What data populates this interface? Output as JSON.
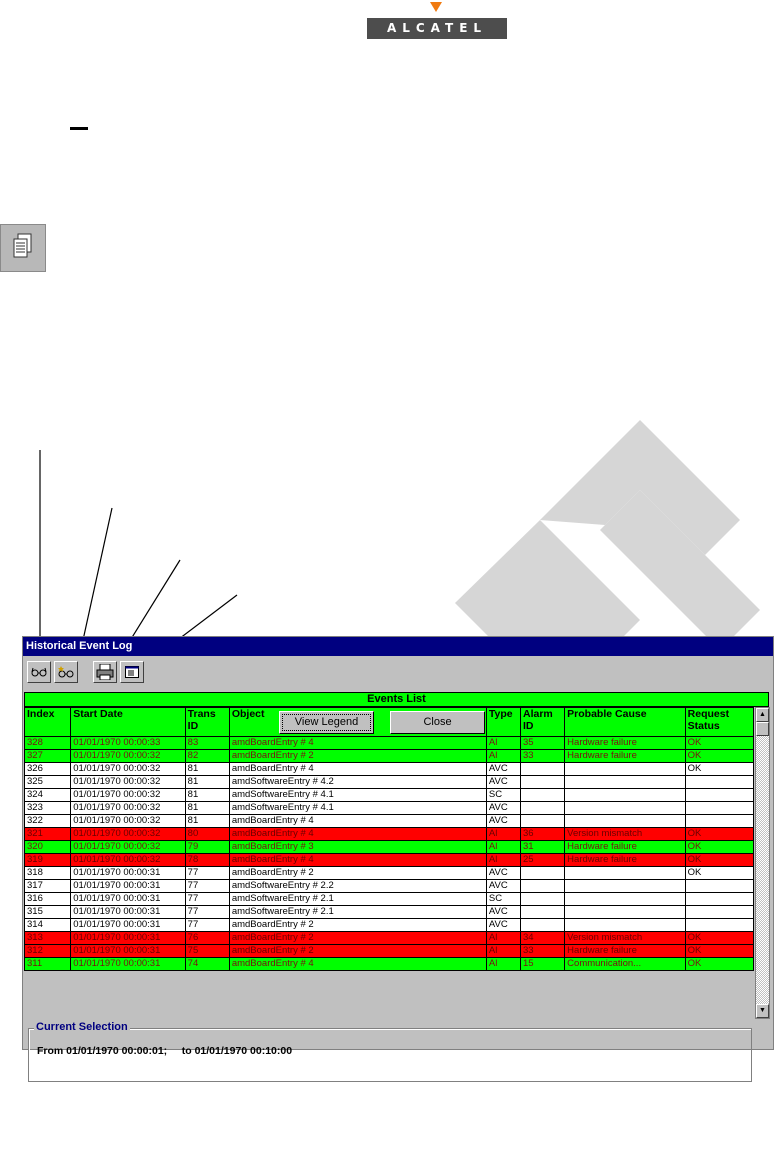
{
  "logo": {
    "text": "ALCATEL"
  },
  "window": {
    "title": "Historical Event Log"
  },
  "toolbar": [
    {
      "name": "view-events-icon",
      "glyph": "○○"
    },
    {
      "name": "view-new-events-icon",
      "glyph": "○○"
    },
    {
      "name": "print-icon",
      "glyph": "🖶"
    },
    {
      "name": "details-icon",
      "glyph": "▤"
    }
  ],
  "events": {
    "title": "Events List",
    "columns": [
      "Index",
      "Start Date",
      "Trans ID",
      "Object",
      "Type",
      "Alarm ID",
      "Probable Cause",
      "Request Status"
    ],
    "rows": [
      {
        "color": "green",
        "cells": [
          "328",
          "01/01/1970 00:00:33",
          "83",
          "amdBoardEntry # 4",
          "Al",
          "35",
          "Hardware failure",
          "OK"
        ]
      },
      {
        "color": "green",
        "cells": [
          "327",
          "01/01/1970 00:00:32",
          "82",
          "amdBoardEntry # 2",
          "Al",
          "33",
          "Hardware failure",
          "OK"
        ]
      },
      {
        "color": "white",
        "cells": [
          "326",
          "01/01/1970 00:00:32",
          "81",
          "amdBoardEntry # 4",
          "AVC",
          "",
          "",
          "OK"
        ]
      },
      {
        "color": "white",
        "cells": [
          "325",
          "01/01/1970 00:00:32",
          "81",
          "amdSoftwareEntry # 4.2",
          "AVC",
          "",
          "",
          ""
        ]
      },
      {
        "color": "white",
        "cells": [
          "324",
          "01/01/1970 00:00:32",
          "81",
          "amdSoftwareEntry # 4.1",
          "SC",
          "",
          "",
          ""
        ]
      },
      {
        "color": "white",
        "cells": [
          "323",
          "01/01/1970 00:00:32",
          "81",
          "amdSoftwareEntry # 4.1",
          "AVC",
          "",
          "",
          ""
        ]
      },
      {
        "color": "white",
        "cells": [
          "322",
          "01/01/1970 00:00:32",
          "81",
          "amdBoardEntry # 4",
          "AVC",
          "",
          "",
          ""
        ]
      },
      {
        "color": "red",
        "cells": [
          "321",
          "01/01/1970 00:00:32",
          "80",
          "amdBoardEntry # 4",
          "Al",
          "36",
          "Version mismatch",
          "OK"
        ]
      },
      {
        "color": "green",
        "cells": [
          "320",
          "01/01/1970 00:00:32",
          "79",
          "amdBoardEntry # 3",
          "Al",
          "31",
          "Hardware failure",
          "OK"
        ]
      },
      {
        "color": "red",
        "cells": [
          "319",
          "01/01/1970 00:00:32",
          "78",
          "amdBoardEntry # 4",
          "Al",
          "25",
          "Hardware failure",
          "OK"
        ]
      },
      {
        "color": "white",
        "cells": [
          "318",
          "01/01/1970 00:00:31",
          "77",
          "amdBoardEntry # 2",
          "AVC",
          "",
          "",
          "OK"
        ]
      },
      {
        "color": "white",
        "cells": [
          "317",
          "01/01/1970 00:00:31",
          "77",
          "amdSoftwareEntry # 2.2",
          "AVC",
          "",
          "",
          ""
        ]
      },
      {
        "color": "white",
        "cells": [
          "316",
          "01/01/1970 00:00:31",
          "77",
          "amdSoftwareEntry # 2.1",
          "SC",
          "",
          "",
          ""
        ]
      },
      {
        "color": "white",
        "cells": [
          "315",
          "01/01/1970 00:00:31",
          "77",
          "amdSoftwareEntry # 2.1",
          "AVC",
          "",
          "",
          ""
        ]
      },
      {
        "color": "white",
        "cells": [
          "314",
          "01/01/1970 00:00:31",
          "77",
          "amdBoardEntry # 2",
          "AVC",
          "",
          "",
          ""
        ]
      },
      {
        "color": "red",
        "cells": [
          "313",
          "01/01/1970 00:00:31",
          "76",
          "amdBoardEntry # 2",
          "Al",
          "34",
          "Version mismatch",
          "OK"
        ]
      },
      {
        "color": "red",
        "cells": [
          "312",
          "01/01/1970 00:00:31",
          "75",
          "amdBoardEntry # 2",
          "Al",
          "33",
          "Hardware failure",
          "OK"
        ]
      },
      {
        "color": "green",
        "cells": [
          "311",
          "01/01/1970 00:00:31",
          "74",
          "amdBoardEntry # 4",
          "Al",
          "15",
          "Communication...",
          "OK"
        ]
      }
    ]
  },
  "selection": {
    "label": "Current Selection",
    "text": "From 01/01/1970 00:00:01;     to 01/01/1970 00:10:00"
  },
  "buttons": {
    "legend": "View Legend",
    "close": "Close"
  },
  "colors": {
    "title_bar": "#000080",
    "green": "#00ff00",
    "red": "#ff0000",
    "window": "#c0c0c0"
  }
}
